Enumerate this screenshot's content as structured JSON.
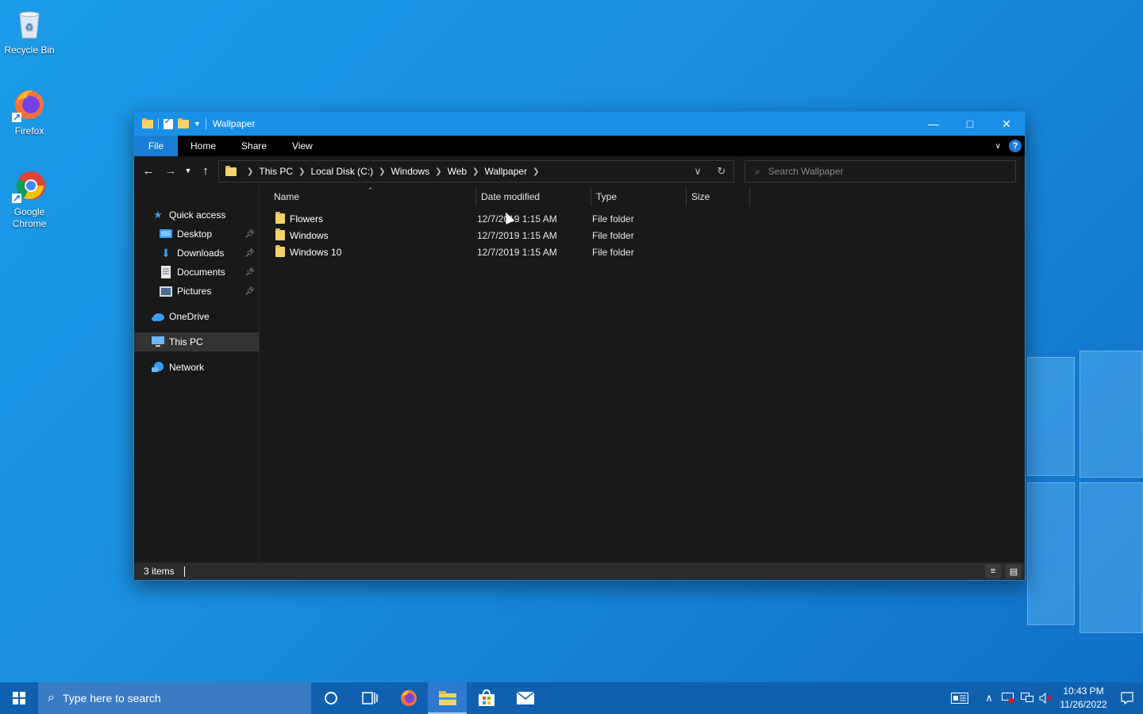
{
  "desktop": {
    "icons": [
      {
        "label": "Recycle Bin"
      },
      {
        "label": "Firefox"
      },
      {
        "label": "Google Chrome"
      }
    ]
  },
  "window": {
    "title": "Wallpaper",
    "ribbon_tabs": [
      "File",
      "Home",
      "Share",
      "View"
    ],
    "breadcrumb": [
      "This PC",
      "Local Disk (C:)",
      "Windows",
      "Web",
      "Wallpaper"
    ],
    "search_placeholder": "Search Wallpaper",
    "nav": {
      "quick_access": "Quick access",
      "desktop": "Desktop",
      "downloads": "Downloads",
      "documents": "Documents",
      "pictures": "Pictures",
      "onedrive": "OneDrive",
      "this_pc": "This PC",
      "network": "Network"
    },
    "columns": {
      "name": "Name",
      "date": "Date modified",
      "type": "Type",
      "size": "Size"
    },
    "files": [
      {
        "name": "Flowers",
        "date": "12/7/2019 1:15 AM",
        "type": "File folder"
      },
      {
        "name": "Windows",
        "date": "12/7/2019 1:15 AM",
        "type": "File folder"
      },
      {
        "name": "Windows 10",
        "date": "12/7/2019 1:15 AM",
        "type": "File folder"
      }
    ],
    "status": "3 items"
  },
  "taskbar": {
    "search_placeholder": "Type here to search",
    "time": "10:43 PM",
    "date": "11/26/2022"
  },
  "colors": {
    "accent": "#1a8fe8",
    "folder": "#f5d36b",
    "explorer_bg": "#191919"
  }
}
